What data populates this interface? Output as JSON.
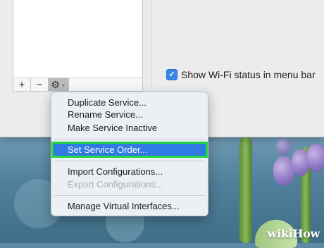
{
  "wifi_status": {
    "label": "Show Wi-Fi status in menu bar",
    "checked": true
  },
  "toolbar": {
    "add_label": "+",
    "remove_label": "−",
    "gear_label": "⚙",
    "chevron": "⌄"
  },
  "menu": {
    "items": [
      {
        "label": "Duplicate Service...",
        "enabled": true
      },
      {
        "label": "Rename Service...",
        "enabled": true
      },
      {
        "label": "Make Service Inactive",
        "enabled": true
      },
      {
        "label": "Set Service Order...",
        "enabled": true,
        "highlighted": true
      },
      {
        "label": "Import Configurations...",
        "enabled": true
      },
      {
        "label": "Export Configurations...",
        "enabled": false
      },
      {
        "label": "Manage Virtual Interfaces...",
        "enabled": true
      }
    ]
  },
  "watermark": {
    "prefix": "wiki",
    "suffix": "How"
  },
  "colors": {
    "highlight": "#2f7ae5",
    "highlight_outline": "#27d640",
    "checkbox": "#3b86e8"
  }
}
